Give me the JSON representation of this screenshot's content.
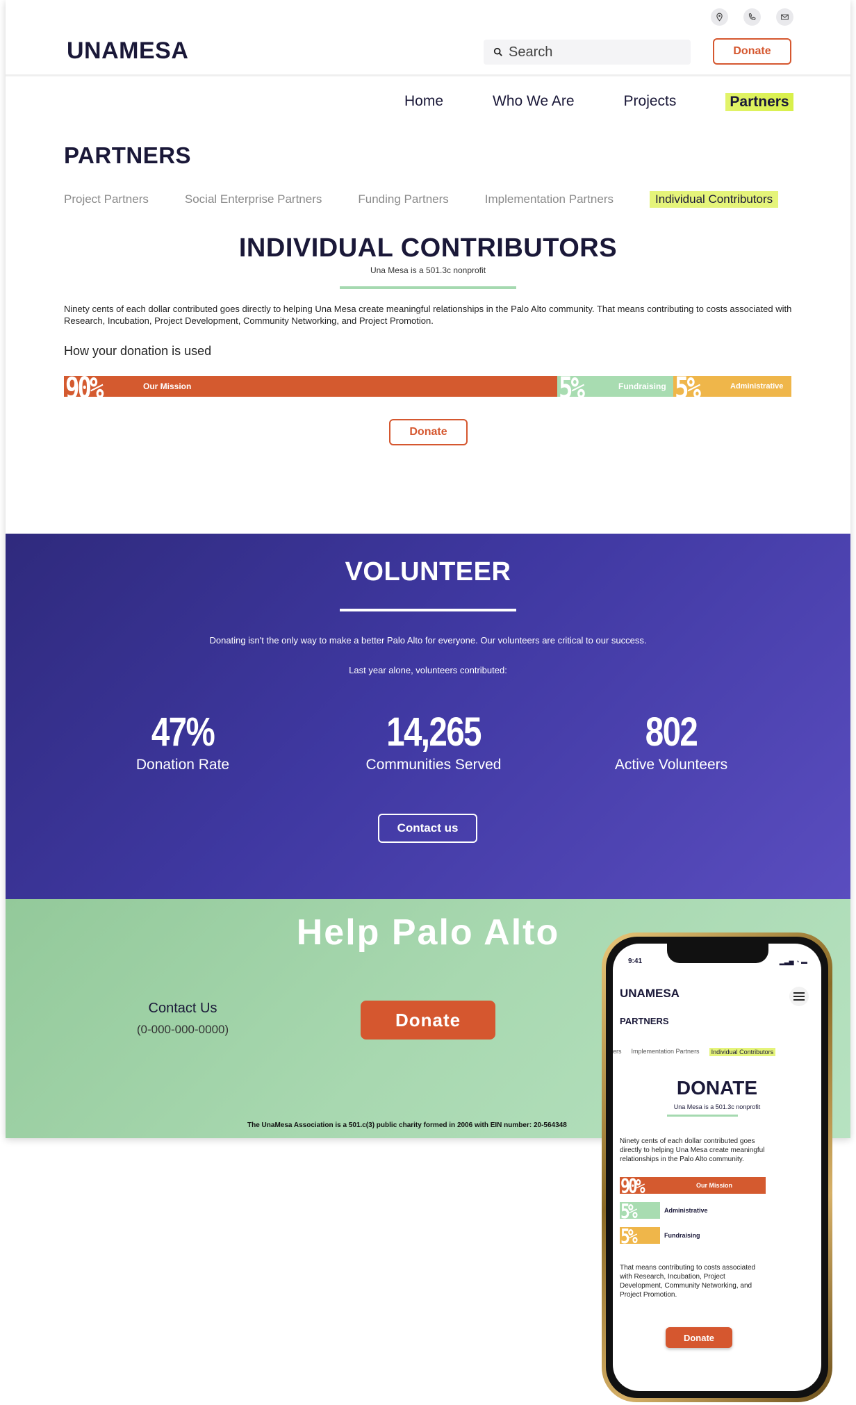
{
  "header": {
    "logo": "UNAMESA",
    "search_placeholder": "Search",
    "donate_label": "Donate",
    "icons": [
      "location-icon",
      "phone-icon",
      "mail-icon"
    ]
  },
  "nav": {
    "items": [
      {
        "label": "Home"
      },
      {
        "label": "Who We Are"
      },
      {
        "label": "Projects"
      },
      {
        "label": "Partners",
        "active": true
      }
    ]
  },
  "page_title": "PARTNERS",
  "subtabs": [
    {
      "label": "Project Partners"
    },
    {
      "label": "Social Enterprise Partners"
    },
    {
      "label": "Funding Partners"
    },
    {
      "label": "Implementation Partners"
    },
    {
      "label": "Individual Contributors",
      "active": true
    }
  ],
  "contributors": {
    "title": "INDIVIDUAL CONTRIBUTORS",
    "subtitle": "Una Mesa is a 501.3c nonprofit",
    "paragraph": "Ninety cents of each dollar contributed goes directly to helping Una Mesa create meaningful relationships in the Palo Alto community. That means contributing to costs associated with Research, Incubation, Project Development, Community Networking, and Project Promotion.",
    "how_used": "How your donation is used",
    "donate_label": "Donate",
    "breakdown": [
      {
        "pct": "90%",
        "value": 90,
        "label": "Our Mission",
        "color": "#d45a2f"
      },
      {
        "pct": "5%",
        "value": 5,
        "label": "Fundraising",
        "color": "#a8dcb1"
      },
      {
        "pct": "5%",
        "value": 5,
        "label": "Administrative",
        "color": "#efb64a"
      }
    ]
  },
  "volunteer": {
    "title": "VOLUNTEER",
    "p1": "Donating isn't the only way to make a better Palo Alto for everyone. Our volunteers are critical to our success.",
    "p2": "Last year alone, volunteers contributed:",
    "stats": [
      {
        "num": "47%",
        "cap": "Donation Rate"
      },
      {
        "num": "14,265",
        "cap": "Communities Served"
      },
      {
        "num": "802",
        "cap": "Active Volunteers"
      }
    ],
    "contact_label": "Contact us"
  },
  "help": {
    "title": "Help Palo Alto",
    "contact_title": "Contact Us",
    "phone": "(0-000-000-0000)",
    "donate_label": "Donate",
    "legal": "The UnaMesa Association is a 501.c(3) public charity formed in 2006 with EIN number: 20-564348"
  },
  "mobile": {
    "time": "9:41",
    "logo": "UNAMESA",
    "section": "PARTNERS",
    "tabs": [
      "ers",
      "Implementation Partners",
      "Individual Contributors"
    ],
    "title": "DONATE",
    "subtitle": "Una Mesa is a 501.3c nonprofit",
    "paragraph": "Ninety cents of each dollar contributed goes directly to helping Una Mesa create meaningful relationships in the Palo Alto community.",
    "rows": [
      {
        "pct": "90%",
        "label": "Our Mission"
      },
      {
        "pct": "5%",
        "label": "Administrative"
      },
      {
        "pct": "5%",
        "label": "Fundraising"
      }
    ],
    "paragraph2": "That means contributing to costs associated with Research, Incubation, Project Development, Community Networking, and Project Promotion.",
    "donate_label": "Donate"
  },
  "colors": {
    "accent": "#d5572f",
    "highlight": "#e5f47a",
    "volunteer_bg": "#3f38a1",
    "help_bg": "#a8d8b0"
  }
}
